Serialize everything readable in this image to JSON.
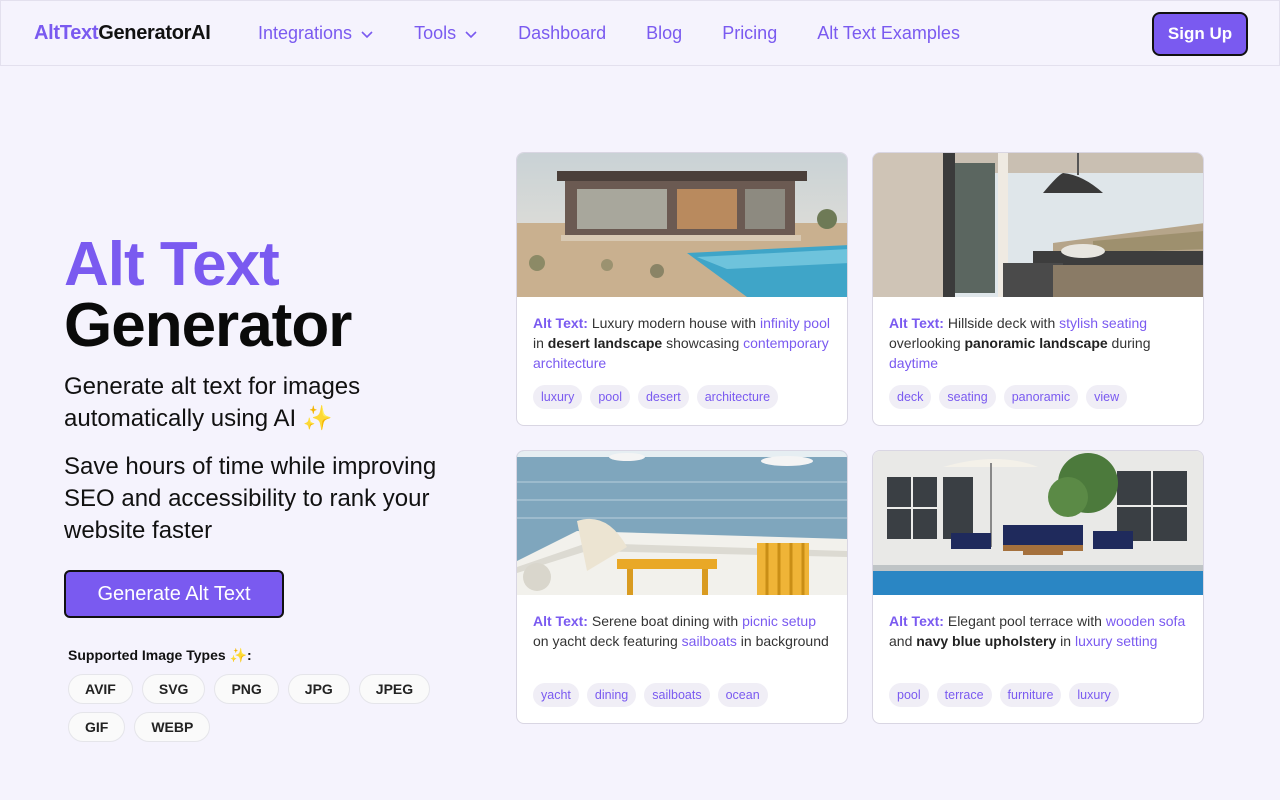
{
  "nav": {
    "logo_a": "AltText",
    "logo_b": "GeneratorAI",
    "links": [
      {
        "label": "Integrations",
        "dropdown": true
      },
      {
        "label": "Tools",
        "dropdown": true
      },
      {
        "label": "Dashboard",
        "dropdown": false
      },
      {
        "label": "Blog",
        "dropdown": false
      },
      {
        "label": "Pricing",
        "dropdown": false
      },
      {
        "label": "Alt Text Examples",
        "dropdown": false
      }
    ],
    "signup": "Sign Up"
  },
  "hero": {
    "title1": "Alt Text",
    "title2": "Generator",
    "sub1": "Generate alt text for images automatically using AI ✨",
    "sub2": "Save hours of time while improving SEO and accessibility to rank your website faster",
    "cta": "Generate Alt Text",
    "supported_label": "Supported Image Types ✨:",
    "types": [
      "AVIF",
      "SVG",
      "PNG",
      "JPG",
      "JPEG",
      "GIF",
      "WEBP"
    ]
  },
  "cards": [
    {
      "image": "modern-desert-house",
      "alt_label": "Alt Text:",
      "desc": [
        {
          "t": " Luxury modern house with ",
          "s": "plain"
        },
        {
          "t": "infinity pool",
          "s": "hl"
        },
        {
          "t": " in ",
          "s": "plain"
        },
        {
          "t": "desert landscape",
          "s": "bold"
        },
        {
          "t": " showcasing ",
          "s": "plain"
        },
        {
          "t": "contemporary architecture",
          "s": "hl"
        }
      ],
      "tags": [
        "luxury",
        "pool",
        "desert",
        "architecture"
      ]
    },
    {
      "image": "hillside-deck",
      "alt_label": "Alt Text:",
      "desc": [
        {
          "t": " Hillside deck with ",
          "s": "plain"
        },
        {
          "t": "stylish seating",
          "s": "hl"
        },
        {
          "t": " overlooking ",
          "s": "plain"
        },
        {
          "t": "panoramic landscape",
          "s": "bold"
        },
        {
          "t": " during ",
          "s": "plain"
        },
        {
          "t": "daytime",
          "s": "hl"
        }
      ],
      "tags": [
        "deck",
        "seating",
        "panoramic",
        "view"
      ]
    },
    {
      "image": "boat-dining",
      "alt_label": "Alt Text:",
      "desc": [
        {
          "t": " Serene boat dining with ",
          "s": "plain"
        },
        {
          "t": "picnic setup",
          "s": "hl"
        },
        {
          "t": " on yacht deck featuring ",
          "s": "plain"
        },
        {
          "t": "sailboats",
          "s": "hl"
        },
        {
          "t": " in background",
          "s": "plain"
        }
      ],
      "tags": [
        "yacht",
        "dining",
        "sailboats",
        "ocean"
      ]
    },
    {
      "image": "pool-terrace",
      "alt_label": "Alt Text:",
      "desc": [
        {
          "t": " Elegant pool terrace with ",
          "s": "plain"
        },
        {
          "t": "wooden sofa",
          "s": "hl"
        },
        {
          "t": " and ",
          "s": "plain"
        },
        {
          "t": "navy blue upholstery",
          "s": "bold"
        },
        {
          "t": " in ",
          "s": "plain"
        },
        {
          "t": "luxury setting",
          "s": "hl"
        }
      ],
      "tags": [
        "pool",
        "terrace",
        "furniture",
        "luxury"
      ]
    }
  ],
  "colors": {
    "accent": "#7a5af0",
    "background": "#f5f3fd"
  }
}
